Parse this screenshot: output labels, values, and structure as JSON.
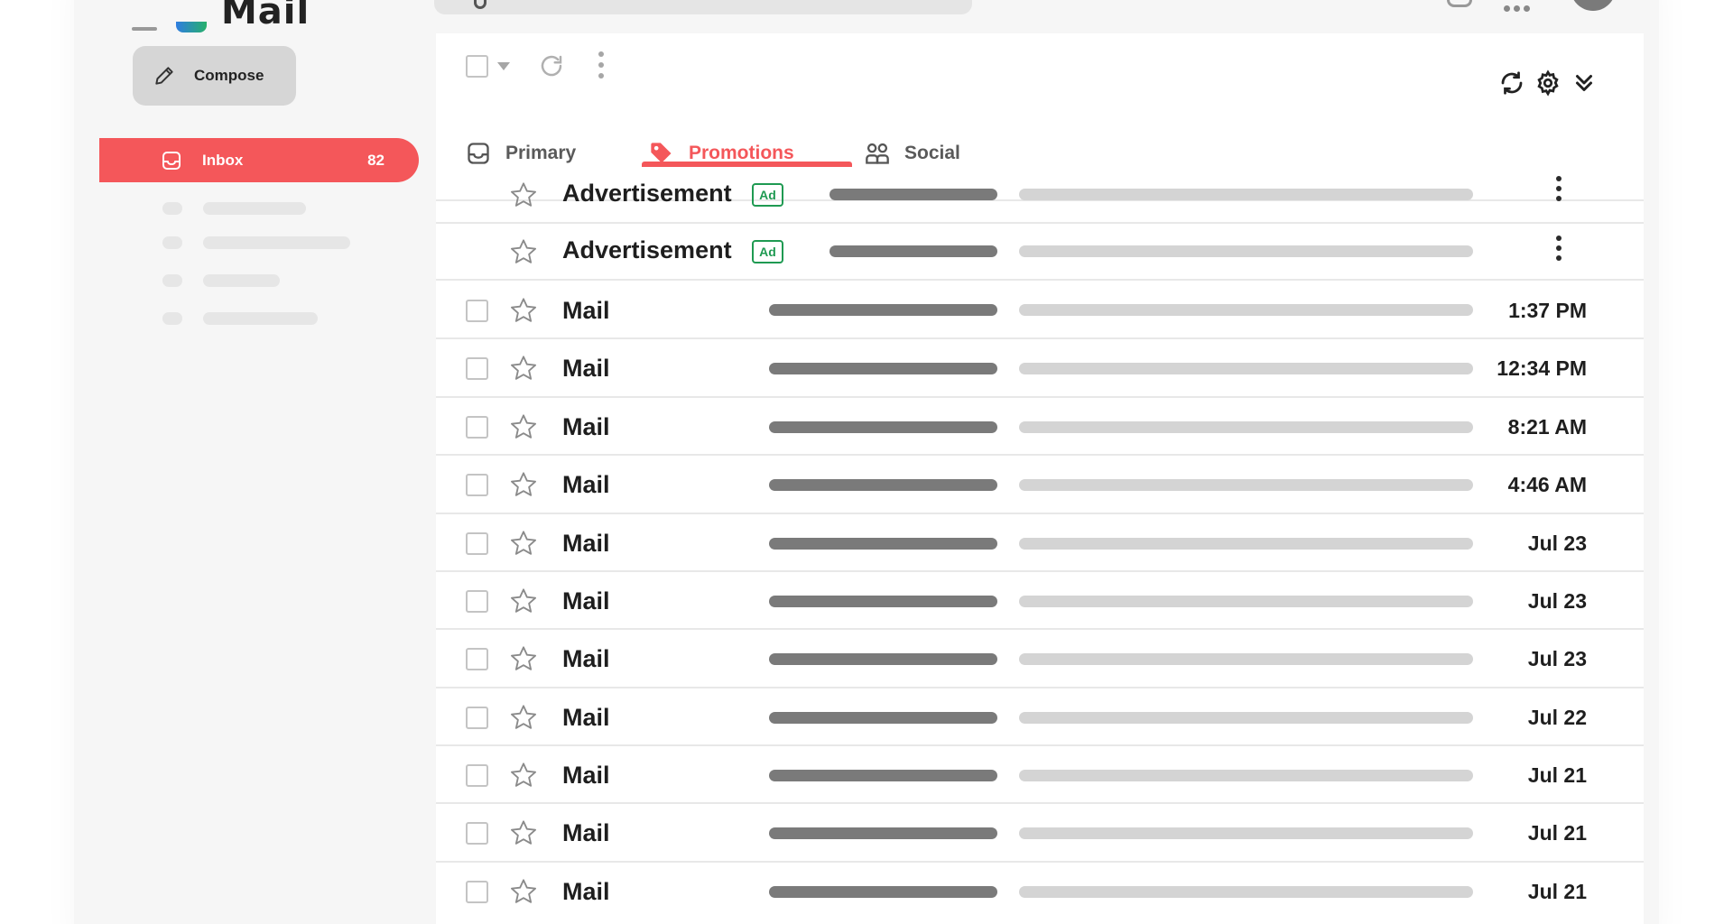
{
  "app": {
    "name": "Mail"
  },
  "compose_label": "Compose",
  "sidebar": {
    "inbox": {
      "label": "Inbox",
      "count": "82"
    }
  },
  "tabs": [
    {
      "label": "Primary",
      "icon": "inbox-tray-icon",
      "active": false
    },
    {
      "label": "Promotions",
      "icon": "tag-icon",
      "active": true
    },
    {
      "label": "Social",
      "icon": "people-icon",
      "active": false
    }
  ],
  "colors": {
    "accent": "#f4575a",
    "ad_badge": "#1f9a52"
  },
  "ads": [
    {
      "sender": "Advertisement",
      "badge": "Ad"
    },
    {
      "sender": "Advertisement",
      "badge": "Ad"
    }
  ],
  "mails": [
    {
      "sender": "Mail",
      "date": "1:37 PM"
    },
    {
      "sender": "Mail",
      "date": "12:34 PM"
    },
    {
      "sender": "Mail",
      "date": "8:21 AM"
    },
    {
      "sender": "Mail",
      "date": "4:46 AM"
    },
    {
      "sender": "Mail",
      "date": "Jul 23"
    },
    {
      "sender": "Mail",
      "date": "Jul 23"
    },
    {
      "sender": "Mail",
      "date": "Jul 23"
    },
    {
      "sender": "Mail",
      "date": "Jul 22"
    },
    {
      "sender": "Mail",
      "date": "Jul 21"
    },
    {
      "sender": "Mail",
      "date": "Jul 21"
    },
    {
      "sender": "Mail",
      "date": "Jul 21"
    }
  ]
}
